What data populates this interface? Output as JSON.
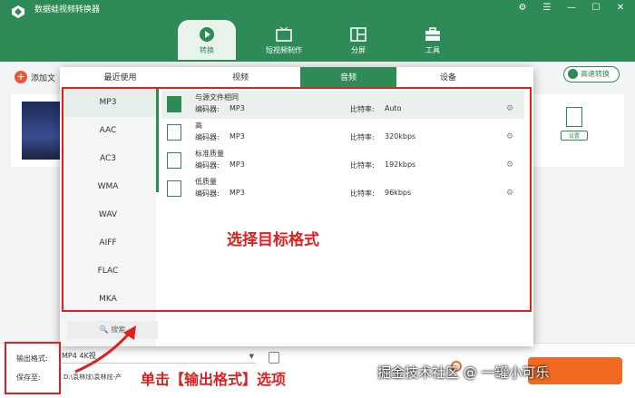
{
  "app": {
    "title": "数据蛙视频转换器"
  },
  "window_controls": [
    "⚙",
    "☰",
    "—",
    "☐",
    "✕"
  ],
  "nav": [
    {
      "label": "转换",
      "icon": "convert-icon",
      "active": true
    },
    {
      "label": "短视频制作",
      "icon": "tv-icon"
    },
    {
      "label": "分屏",
      "icon": "split-screen-icon"
    },
    {
      "label": "工具",
      "icon": "toolbox-icon"
    }
  ],
  "toolbar": {
    "add_file": "添加文",
    "fast_convert": "高速转换"
  },
  "video": {
    "settings_label": "设置"
  },
  "popup": {
    "tabs": [
      "最近使用",
      "视频",
      "音频",
      "设备"
    ],
    "active_tab": "音频",
    "formats": [
      "MP3",
      "AAC",
      "AC3",
      "WMA",
      "WAV",
      "AIFF",
      "FLAC",
      "MKA"
    ],
    "active_format": "MP3",
    "search_label": "搜索",
    "presets": [
      {
        "name": "与源文件相同",
        "encoder_label": "编码器:",
        "encoder": "MP3",
        "bitrate_label": "比特率:",
        "bitrate": "Auto"
      },
      {
        "name": "高",
        "encoder_label": "编码器:",
        "encoder": "MP3",
        "bitrate_label": "比特率:",
        "bitrate": "320kbps"
      },
      {
        "name": "标准质量",
        "encoder_label": "编码器:",
        "encoder": "MP3",
        "bitrate_label": "比特率:",
        "bitrate": "192kbps"
      },
      {
        "name": "低质量",
        "encoder_label": "编码器:",
        "encoder": "MP3",
        "bitrate_label": "比特率:",
        "bitrate": "96kbps"
      }
    ]
  },
  "bottom": {
    "output_label": "输出格式:",
    "output_value": "MP4 4K视",
    "save_label": "保存至:",
    "save_path": "D:\\袁林炫\\袁林炫-产"
  },
  "annotations": {
    "select_target": "选择目标格式",
    "click_output": "单击【输出格式】选项",
    "watermark": "掘金技术社区 @ 一罐小可乐"
  },
  "colors": {
    "primary": "#2e8b57",
    "accent": "#f26a21",
    "highlight": "#e02020"
  }
}
